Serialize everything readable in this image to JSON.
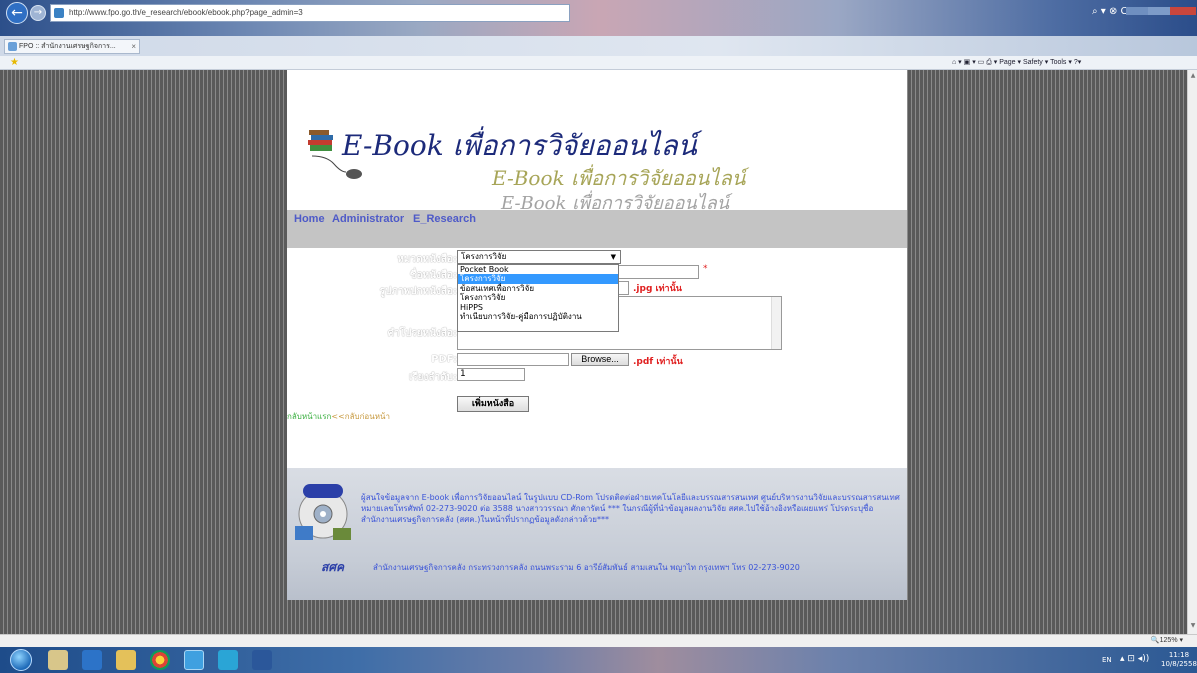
{
  "browser": {
    "url": "http://www.fpo.go.th/e_research/ebook/ebook.php?page_admin=3",
    "tab_title": "FPO :: สำนักงานเศรษฐกิจการ...",
    "tab_close": "×",
    "address_tools": "⌕ ▾ ⊗ C ✕",
    "command_bar": "⌂ ▾ ▣ ▾ ▭ ⎙ ▾ Page ▾ Safety ▾ Tools ▾ ?▾",
    "zoom": "🔍125% ▾",
    "back": "←",
    "forward": "→"
  },
  "site": {
    "banner": {
      "title_line1": "E-Book เพื่อการวิจัยออนไลน์",
      "title_line2": "E-Book เพื่อการวิจัยออนไลน์",
      "title_line3": "E-Book เพื่อการวิจัยออนไลน์"
    },
    "nav": {
      "home": "Home",
      "admin": "Administrator",
      "research": "E_Research"
    },
    "form": {
      "category_label": "หมวดหนังสือ:",
      "category_value": "โครงการวิจัย",
      "category_options": [
        "Pocket Book",
        "โครงการวิจัย",
        "ข้อสนเทศเพื่อการวิจัย",
        "โครงการวิจัย",
        "HiPPS",
        "ทำเนียบการวิจัย-คู่มือการปฏิบัติงาน"
      ],
      "category_selected_index": 1,
      "title_label": "ชื่อหนังสือ:",
      "required_mark": "*",
      "cover_label": "รูปภาพปกหนังสือ:",
      "cover_hint": ".jpg เท่านั้น",
      "desc_label": "คำโปรยหนังสือ:",
      "pdf_label": "PDF:",
      "browse_label": "Browse...",
      "pdf_hint": ".pdf เท่านั้น",
      "order_label": "เรียงลำดับ:",
      "order_value": "1",
      "submit_label": "เพิ่มหนังสือ",
      "back_link_prefix": "กลับหน้าแรก",
      "back_link": "<<กลับก่อนหน้า"
    },
    "footer": {
      "note": "ผู้สนใจข้อมูลจาก E-book เพื่อการวิจัยออนไลน์ ในรูปแบบ CD-Rom โปรดติดต่อฝ่ายเทคโนโลยีและบรรณสารสนเทศ ศูนย์บริหารงานวิจัยและบรรณสารสนเทศ หมายเลขโทรศัพท์ 02-273-9020 ต่อ 3588 นางสาววรรณา ศักดารัตน์ *** ในกรณีผู้ที่นำข้อมูลผลงานวิจัย สศค.ไปใช้อ้างอิงหรือเผยแพร่ โปรดระบุชื่อสำนักงานเศรษฐกิจการคลัง (สศค.)ในหน้าที่ปรากฏข้อมูลดังกล่าวด้วย***",
      "logo_text": "สศค",
      "address": "สำนักงานเศรษฐกิจการคลัง กระทรวงการคลัง ถนนพระราม 6 อารีย์สัมพันธ์ สามเสนใน พญาไท กรุงเทพฯ โทร 02-273-9020"
    }
  },
  "taskbar": {
    "language": "EN",
    "tray": "▴ ⊡ ◂))",
    "time": "11:18",
    "date": "10/8/2558"
  },
  "colors": {
    "nav_link": "#4e5ac8",
    "hint_red": "#e02020",
    "footer_text": "#3a53d8",
    "dropdown_selected": "#3399ff"
  }
}
